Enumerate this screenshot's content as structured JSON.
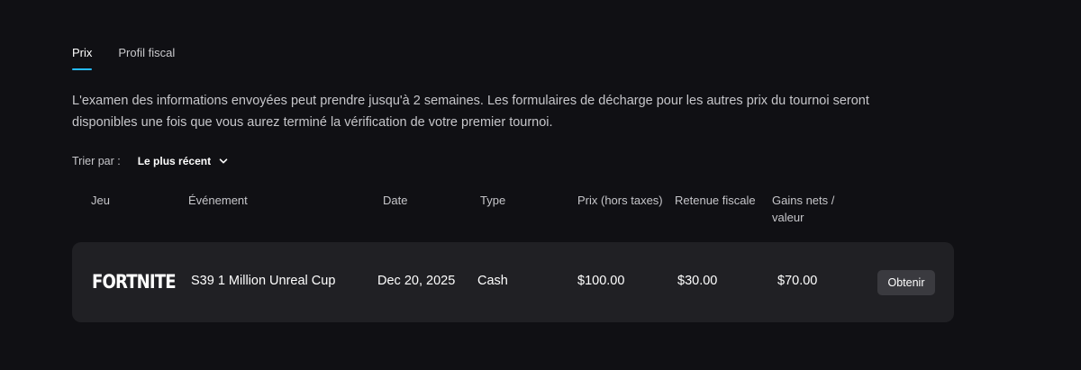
{
  "tabs": [
    {
      "label": "Prix",
      "active": true
    },
    {
      "label": "Profil fiscal",
      "active": false
    }
  ],
  "intro_text": "L'examen des informations envoyées peut prendre jusqu'à 2 semaines. Les formulaires de décharge pour les autres prix du tournoi seront disponibles une fois que vous aurez terminé la vérification de votre premier tournoi.",
  "sort": {
    "label": "Trier par :",
    "selected": "Le plus récent",
    "icon": "chevron-down-icon"
  },
  "table": {
    "headers": {
      "game": "Jeu",
      "event": "Événement",
      "date": "Date",
      "type": "Type",
      "prize": "Prix (hors taxes)",
      "withholding": "Retenue fiscale",
      "net_line1": "Gains nets /",
      "net_line2": "valeur"
    },
    "rows": [
      {
        "game_logo": "FORTNITE",
        "event": "S39 1 Million Unreal Cup",
        "date": "Dec 20, 2025",
        "type": "Cash",
        "prize": "$100.00",
        "withholding": "$30.00",
        "net": "$70.00",
        "action_label": "Obtenir"
      }
    ]
  },
  "colors": {
    "background": "#101014",
    "row_background": "#202024",
    "accent": "#26bbff",
    "button_background": "#3a3a3f"
  }
}
